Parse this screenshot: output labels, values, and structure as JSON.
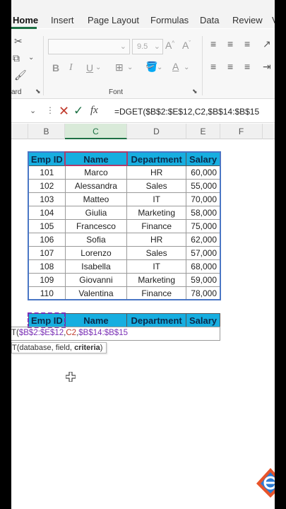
{
  "ribbon": {
    "tabs": [
      {
        "label": "Home"
      },
      {
        "label": "Insert"
      },
      {
        "label": "Page Layout"
      },
      {
        "label": "Formulas"
      },
      {
        "label": "Data"
      },
      {
        "label": "Review"
      },
      {
        "label": "V"
      }
    ],
    "font_size_value": "9.5",
    "group_clipboard_label": "ard",
    "group_font_label": "Font"
  },
  "formula_bar": {
    "fx_label": "fx",
    "formula": "=DGET($B$2:$E$12,C2,$B$14:$B$15"
  },
  "column_headers": [
    "B",
    "C",
    "D",
    "E",
    "F"
  ],
  "table": {
    "headers": [
      "Emp ID",
      "Name",
      "Department",
      "Salary"
    ],
    "rows": [
      [
        "101",
        "Marco",
        "HR",
        "60,000"
      ],
      [
        "102",
        "Alessandra",
        "Sales",
        "55,000"
      ],
      [
        "103",
        "Matteo",
        "IT",
        "70,000"
      ],
      [
        "104",
        "Giulia",
        "Marketing",
        "58,000"
      ],
      [
        "105",
        "Francesco",
        "Finance",
        "75,000"
      ],
      [
        "106",
        "Sofia",
        "HR",
        "62,000"
      ],
      [
        "107",
        "Lorenzo",
        "Sales",
        "57,000"
      ],
      [
        "108",
        "Isabella",
        "IT",
        "68,000"
      ],
      [
        "109",
        "Giovanni",
        "Marketing",
        "59,000"
      ],
      [
        "110",
        "Valentina",
        "Finance",
        "78,000"
      ]
    ]
  },
  "criteria_table": {
    "headers": [
      "Emp ID",
      "Name",
      "Department",
      "Salary"
    ],
    "formula_parts": {
      "prefix": "T(",
      "range1": "$B$2:$E$12",
      "comma1": ",",
      "field": "C2",
      "comma2": ",",
      "range2": "$B$14:$B$15"
    },
    "tooltip": {
      "prefix": "T(database, field, ",
      "bold": "criteria",
      "suffix": ")"
    }
  },
  "colors": {
    "header_fill": "#17aee0",
    "accent": "#1e7145"
  }
}
